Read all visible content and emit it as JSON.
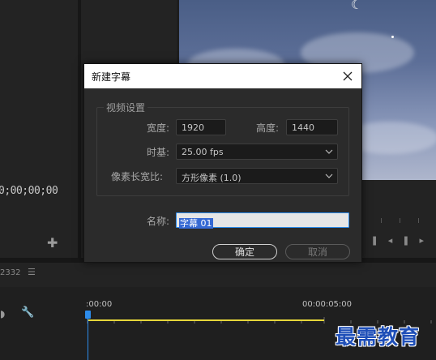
{
  "background": {
    "timecode": "0;00;00;00",
    "timeline_number": "2332",
    "ruler_start": ":00:00",
    "ruler_mark": "00:00:05:00"
  },
  "watermark": "最需教育",
  "dialog": {
    "title": "新建字幕",
    "video_settings": {
      "group_label": "视频设置",
      "width_label": "宽度:",
      "width_value": "1920",
      "height_label": "高度:",
      "height_value": "1440",
      "timebase_label": "时基:",
      "timebase_value": "25.00 fps",
      "par_label": "像素长宽比:",
      "par_value": "方形像素 (1.0)"
    },
    "name_label": "名称:",
    "name_value": "字幕 01",
    "ok_label": "确定",
    "cancel_label": "取消"
  },
  "colors": {
    "accent": "#2d8ceb",
    "selection": "#3569d4",
    "timeline_bar": "#e6d63a"
  }
}
